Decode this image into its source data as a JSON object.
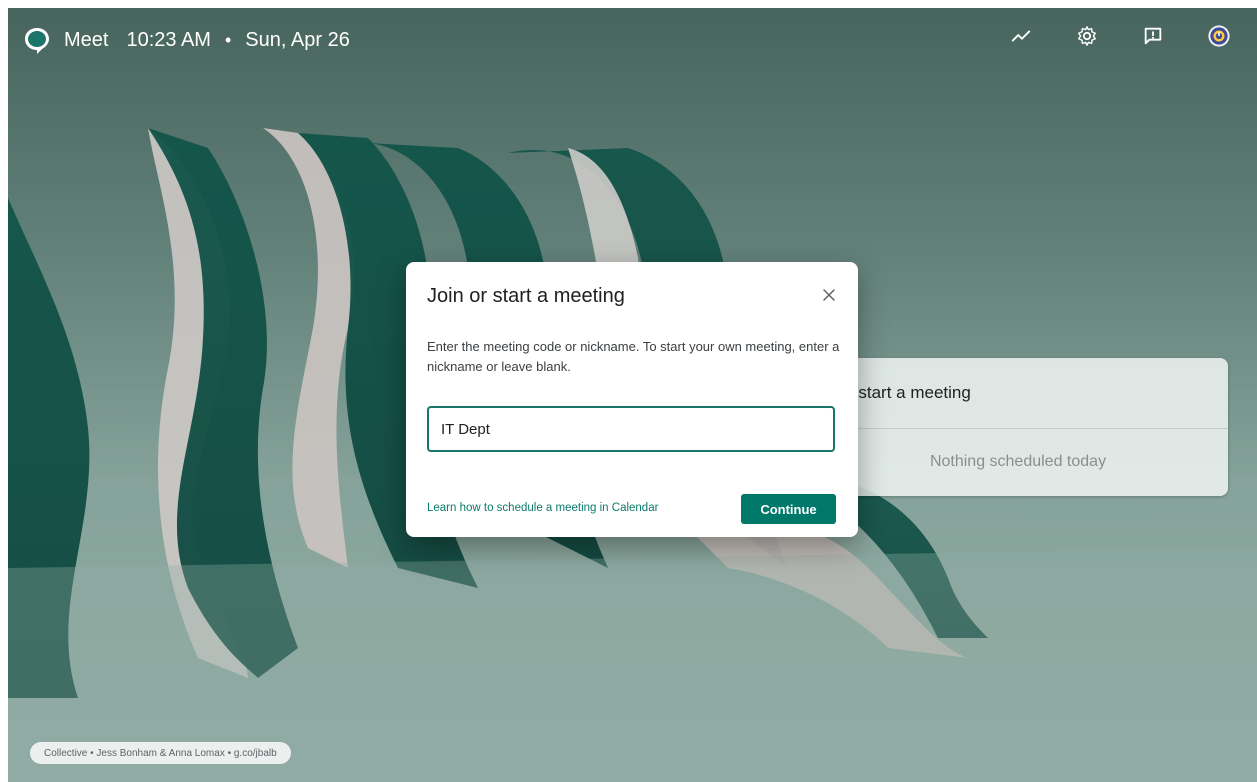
{
  "colors": {
    "accent": "#00796b",
    "dialog_bg": "#ffffff",
    "topbar_text": "#ffffff"
  },
  "header": {
    "app_name": "Meet",
    "time": "10:23 AM",
    "separator": "•",
    "date": "Sun, Apr 26",
    "icons": [
      "trending-icon",
      "settings-gear-icon",
      "feedback-icon",
      "profile-avatar"
    ]
  },
  "side_panel": {
    "heading": "r start a meeting",
    "empty_state": "Nothing scheduled today"
  },
  "dialog": {
    "title": "Join or start a meeting",
    "description": "Enter the meeting code or nickname. To start your own meeting, enter a nickname or leave blank.",
    "input_value": "IT Dept",
    "link_label": "Learn how to schedule a meeting in Calendar",
    "continue_label": "Continue"
  },
  "footer": {
    "credit": "Collective • Jess Bonham & Anna Lomax • g.co/jbalb"
  }
}
